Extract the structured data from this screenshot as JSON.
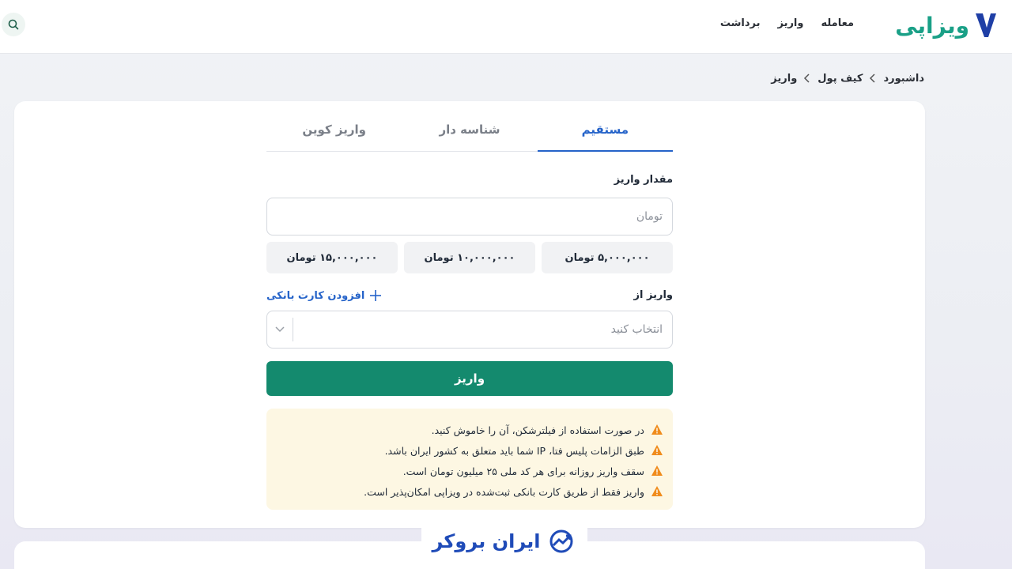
{
  "header": {
    "logo_text": "ویزاپی",
    "nav": [
      "معامله",
      "واریز",
      "برداشت"
    ]
  },
  "breadcrumb": [
    "داشبورد",
    "کیف پول",
    "واریز"
  ],
  "tabs": [
    {
      "label": "مستقیم",
      "active": true
    },
    {
      "label": "شناسه دار",
      "active": false
    },
    {
      "label": "واریز کوین",
      "active": false
    }
  ],
  "form": {
    "amount_label": "مقدار واریز",
    "amount_placeholder": "تومان",
    "presets": [
      "۵,۰۰۰,۰۰۰ تومان",
      "۱۰,۰۰۰,۰۰۰ تومان",
      "۱۵,۰۰۰,۰۰۰ تومان"
    ],
    "source_label": "واریز از",
    "add_card_label": "افزودن کارت بانکی",
    "select_placeholder": "انتخاب کنید",
    "submit_label": "واریز"
  },
  "notices": [
    "در صورت استفاده از فیلترشکن، آن را خاموش کنید.",
    "طبق الزامات پلیس فتا، IP شما باید متعلق به کشور ایران باشد.",
    "سقف واریز روزانه برای هر کد ملی ۲۵ میلیون تومان است.",
    "واریز فقط از طریق کارت بانکی ثبت‌شده در ویزاپی امکان‌پذیر است."
  ],
  "watermark": "ایران بروکر",
  "colors": {
    "accent_blue": "#2563c9",
    "primary_green": "#148a6e",
    "warning_orange": "#f08c1c",
    "notice_bg": "#fdf7e3"
  },
  "icons": [
    "search-icon",
    "chevron-left-icon",
    "plus-icon",
    "chevron-down-icon",
    "warning-icon"
  ]
}
